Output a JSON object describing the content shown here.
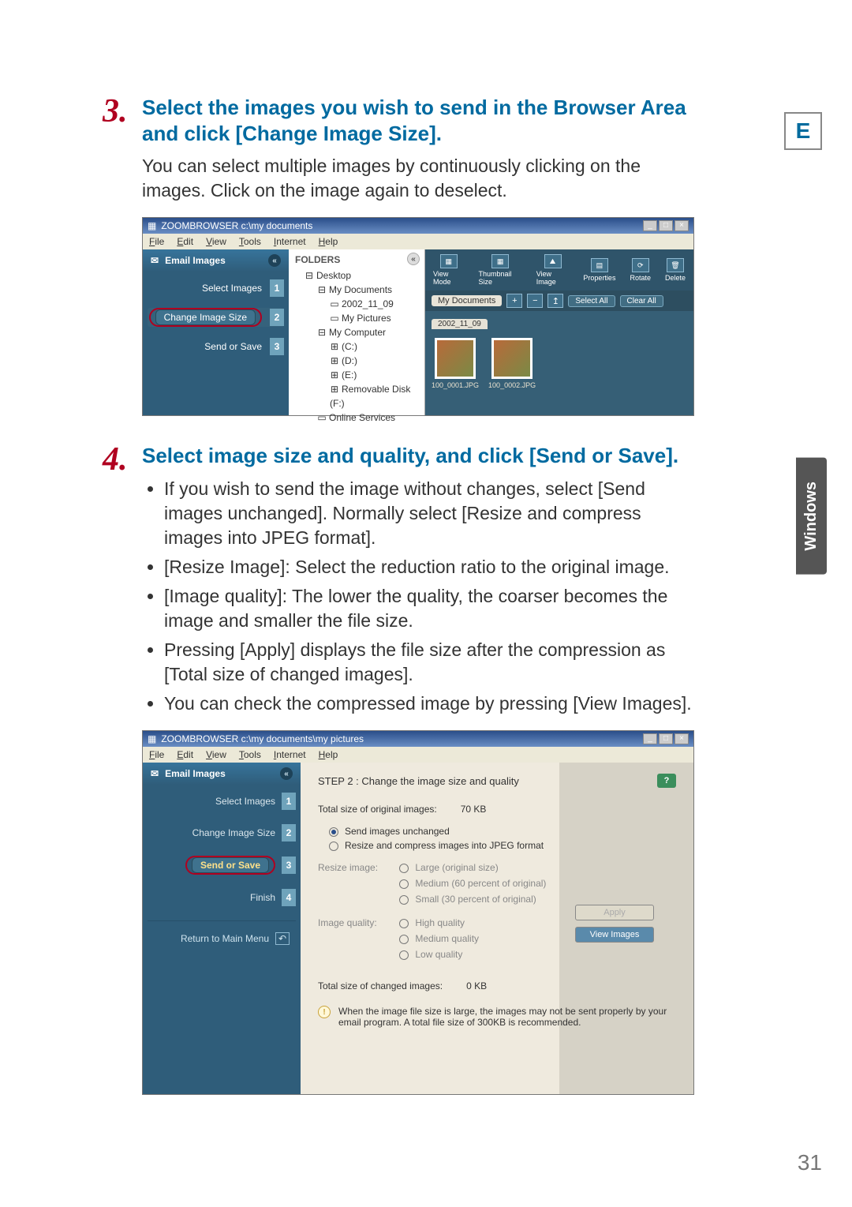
{
  "sideTab": "E",
  "sideLabel": "Windows",
  "pageNumber": "31",
  "step3": {
    "num": "3.",
    "title": "Select the images you wish to send in the Browser Area and click [Change Image Size].",
    "desc": "You can select multiple images by continuously clicking on the images. Click on the image again to deselect."
  },
  "win1": {
    "title": "ZOOMBROWSER c:\\my documents",
    "menus": [
      "File",
      "Edit",
      "View",
      "Tools",
      "Internet",
      "Help"
    ],
    "winBtns": [
      "_",
      "□",
      "×"
    ],
    "sidebarHeader": "Email Images",
    "sbSteps": [
      {
        "label": "Select Images",
        "num": "1"
      },
      {
        "label": "Change Image Size",
        "num": "2"
      },
      {
        "label": "Send or Save",
        "num": "3"
      }
    ],
    "foldersTitle": "FOLDERS",
    "tree": {
      "desktop": "Desktop",
      "mydocs": "My Documents",
      "date": "2002_11_09",
      "mypics": "My Pictures",
      "mycomp": "My Computer",
      "c": "(C:)",
      "d": "(D:)",
      "e": "(E:)",
      "rem": "Removable Disk (F:)",
      "online": "Online Services"
    },
    "toolbar": {
      "viewMode": "View Mode",
      "thumbSize": "Thumbnail Size",
      "viewImage": "View Image",
      "properties": "Properties",
      "rotate": "Rotate",
      "delete": "Delete"
    },
    "location": "My Documents",
    "selectAll": "Select All",
    "clearAll": "Clear All",
    "dateTab": "2002_11_09",
    "thumbs": [
      "100_0001.JPG",
      "100_0002.JPG"
    ]
  },
  "step4": {
    "num": "4.",
    "title": "Select image size and quality, and click [Send or Save].",
    "bullets": [
      "If you wish to send the image without changes, select [Send images unchanged]. Normally select [Resize and compress images into JPEG format].",
      "[Resize Image]: Select the reduction ratio to the original image.",
      "[Image quality]: The lower the quality, the coarser becomes the image and smaller the file size.",
      "Pressing [Apply] displays the file size after the compression as [Total size of changed images].",
      "You can check the compressed image by pressing [View Images]."
    ]
  },
  "win2": {
    "title": "ZOOMBROWSER c:\\my documents\\my pictures",
    "menus": [
      "File",
      "Edit",
      "View",
      "Tools",
      "Internet",
      "Help"
    ],
    "winBtns": [
      "_",
      "□",
      "×"
    ],
    "sidebarHeader": "Email Images",
    "sbSteps": [
      {
        "label": "Select Images",
        "num": "1"
      },
      {
        "label": "Change Image Size",
        "num": "2"
      },
      {
        "label": "Send or Save",
        "num": "3"
      },
      {
        "label": "Finish",
        "num": "4"
      }
    ],
    "return": "Return to Main Menu",
    "stepHeader": "STEP 2 : Change the image size and quality",
    "totalOrigLbl": "Total size of original images:",
    "totalOrigVal": "70 KB",
    "optUnchanged": "Send images unchanged",
    "optResize": "Resize and compress images into JPEG format",
    "resizeLbl": "Resize image:",
    "resizeOpts": [
      "Large (original size)",
      "Medium (60 percent of original)",
      "Small (30 percent of original)"
    ],
    "qualityLbl": "Image quality:",
    "qualityOpts": [
      "High quality",
      "Medium quality",
      "Low quality"
    ],
    "totalChgLbl": "Total size of changed images:",
    "totalChgVal": "0 KB",
    "applyBtn": "Apply",
    "viewBtn": "View Images",
    "info": "When the image file size is large, the images may not be sent properly by your email program. A total file size of 300KB is recommended."
  }
}
